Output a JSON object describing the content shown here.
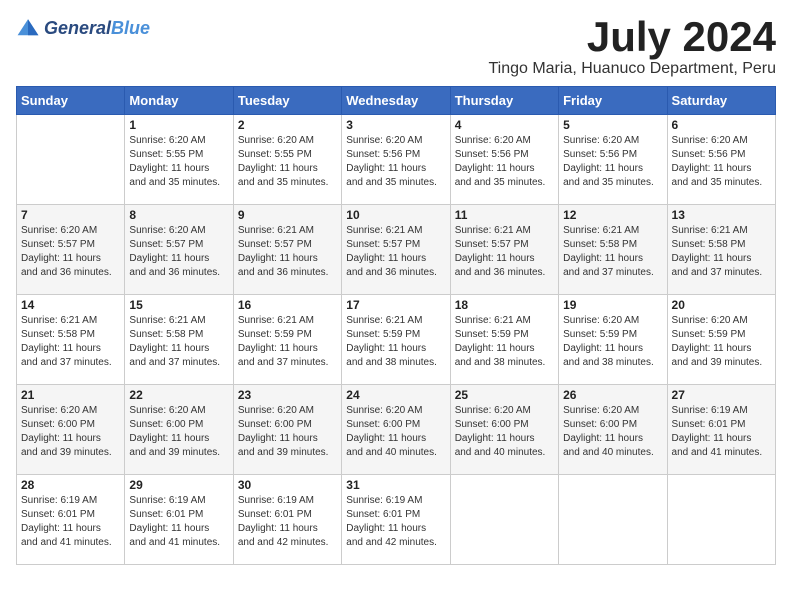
{
  "logo": {
    "text_general": "General",
    "text_blue": "Blue"
  },
  "title": {
    "month": "July 2024",
    "location": "Tingo Maria, Huanuco Department, Peru"
  },
  "headers": [
    "Sunday",
    "Monday",
    "Tuesday",
    "Wednesday",
    "Thursday",
    "Friday",
    "Saturday"
  ],
  "weeks": [
    [
      {
        "day": "",
        "sunrise": "",
        "sunset": "",
        "daylight": ""
      },
      {
        "day": "1",
        "sunrise": "Sunrise: 6:20 AM",
        "sunset": "Sunset: 5:55 PM",
        "daylight": "Daylight: 11 hours and 35 minutes."
      },
      {
        "day": "2",
        "sunrise": "Sunrise: 6:20 AM",
        "sunset": "Sunset: 5:55 PM",
        "daylight": "Daylight: 11 hours and 35 minutes."
      },
      {
        "day": "3",
        "sunrise": "Sunrise: 6:20 AM",
        "sunset": "Sunset: 5:56 PM",
        "daylight": "Daylight: 11 hours and 35 minutes."
      },
      {
        "day": "4",
        "sunrise": "Sunrise: 6:20 AM",
        "sunset": "Sunset: 5:56 PM",
        "daylight": "Daylight: 11 hours and 35 minutes."
      },
      {
        "day": "5",
        "sunrise": "Sunrise: 6:20 AM",
        "sunset": "Sunset: 5:56 PM",
        "daylight": "Daylight: 11 hours and 35 minutes."
      },
      {
        "day": "6",
        "sunrise": "Sunrise: 6:20 AM",
        "sunset": "Sunset: 5:56 PM",
        "daylight": "Daylight: 11 hours and 35 minutes."
      }
    ],
    [
      {
        "day": "7",
        "sunrise": "Sunrise: 6:20 AM",
        "sunset": "Sunset: 5:57 PM",
        "daylight": "Daylight: 11 hours and 36 minutes."
      },
      {
        "day": "8",
        "sunrise": "Sunrise: 6:20 AM",
        "sunset": "Sunset: 5:57 PM",
        "daylight": "Daylight: 11 hours and 36 minutes."
      },
      {
        "day": "9",
        "sunrise": "Sunrise: 6:21 AM",
        "sunset": "Sunset: 5:57 PM",
        "daylight": "Daylight: 11 hours and 36 minutes."
      },
      {
        "day": "10",
        "sunrise": "Sunrise: 6:21 AM",
        "sunset": "Sunset: 5:57 PM",
        "daylight": "Daylight: 11 hours and 36 minutes."
      },
      {
        "day": "11",
        "sunrise": "Sunrise: 6:21 AM",
        "sunset": "Sunset: 5:57 PM",
        "daylight": "Daylight: 11 hours and 36 minutes."
      },
      {
        "day": "12",
        "sunrise": "Sunrise: 6:21 AM",
        "sunset": "Sunset: 5:58 PM",
        "daylight": "Daylight: 11 hours and 37 minutes."
      },
      {
        "day": "13",
        "sunrise": "Sunrise: 6:21 AM",
        "sunset": "Sunset: 5:58 PM",
        "daylight": "Daylight: 11 hours and 37 minutes."
      }
    ],
    [
      {
        "day": "14",
        "sunrise": "Sunrise: 6:21 AM",
        "sunset": "Sunset: 5:58 PM",
        "daylight": "Daylight: 11 hours and 37 minutes."
      },
      {
        "day": "15",
        "sunrise": "Sunrise: 6:21 AM",
        "sunset": "Sunset: 5:58 PM",
        "daylight": "Daylight: 11 hours and 37 minutes."
      },
      {
        "day": "16",
        "sunrise": "Sunrise: 6:21 AM",
        "sunset": "Sunset: 5:59 PM",
        "daylight": "Daylight: 11 hours and 37 minutes."
      },
      {
        "day": "17",
        "sunrise": "Sunrise: 6:21 AM",
        "sunset": "Sunset: 5:59 PM",
        "daylight": "Daylight: 11 hours and 38 minutes."
      },
      {
        "day": "18",
        "sunrise": "Sunrise: 6:21 AM",
        "sunset": "Sunset: 5:59 PM",
        "daylight": "Daylight: 11 hours and 38 minutes."
      },
      {
        "day": "19",
        "sunrise": "Sunrise: 6:20 AM",
        "sunset": "Sunset: 5:59 PM",
        "daylight": "Daylight: 11 hours and 38 minutes."
      },
      {
        "day": "20",
        "sunrise": "Sunrise: 6:20 AM",
        "sunset": "Sunset: 5:59 PM",
        "daylight": "Daylight: 11 hours and 39 minutes."
      }
    ],
    [
      {
        "day": "21",
        "sunrise": "Sunrise: 6:20 AM",
        "sunset": "Sunset: 6:00 PM",
        "daylight": "Daylight: 11 hours and 39 minutes."
      },
      {
        "day": "22",
        "sunrise": "Sunrise: 6:20 AM",
        "sunset": "Sunset: 6:00 PM",
        "daylight": "Daylight: 11 hours and 39 minutes."
      },
      {
        "day": "23",
        "sunrise": "Sunrise: 6:20 AM",
        "sunset": "Sunset: 6:00 PM",
        "daylight": "Daylight: 11 hours and 39 minutes."
      },
      {
        "day": "24",
        "sunrise": "Sunrise: 6:20 AM",
        "sunset": "Sunset: 6:00 PM",
        "daylight": "Daylight: 11 hours and 40 minutes."
      },
      {
        "day": "25",
        "sunrise": "Sunrise: 6:20 AM",
        "sunset": "Sunset: 6:00 PM",
        "daylight": "Daylight: 11 hours and 40 minutes."
      },
      {
        "day": "26",
        "sunrise": "Sunrise: 6:20 AM",
        "sunset": "Sunset: 6:00 PM",
        "daylight": "Daylight: 11 hours and 40 minutes."
      },
      {
        "day": "27",
        "sunrise": "Sunrise: 6:19 AM",
        "sunset": "Sunset: 6:01 PM",
        "daylight": "Daylight: 11 hours and 41 minutes."
      }
    ],
    [
      {
        "day": "28",
        "sunrise": "Sunrise: 6:19 AM",
        "sunset": "Sunset: 6:01 PM",
        "daylight": "Daylight: 11 hours and 41 minutes."
      },
      {
        "day": "29",
        "sunrise": "Sunrise: 6:19 AM",
        "sunset": "Sunset: 6:01 PM",
        "daylight": "Daylight: 11 hours and 41 minutes."
      },
      {
        "day": "30",
        "sunrise": "Sunrise: 6:19 AM",
        "sunset": "Sunset: 6:01 PM",
        "daylight": "Daylight: 11 hours and 42 minutes."
      },
      {
        "day": "31",
        "sunrise": "Sunrise: 6:19 AM",
        "sunset": "Sunset: 6:01 PM",
        "daylight": "Daylight: 11 hours and 42 minutes."
      },
      {
        "day": "",
        "sunrise": "",
        "sunset": "",
        "daylight": ""
      },
      {
        "day": "",
        "sunrise": "",
        "sunset": "",
        "daylight": ""
      },
      {
        "day": "",
        "sunrise": "",
        "sunset": "",
        "daylight": ""
      }
    ]
  ]
}
